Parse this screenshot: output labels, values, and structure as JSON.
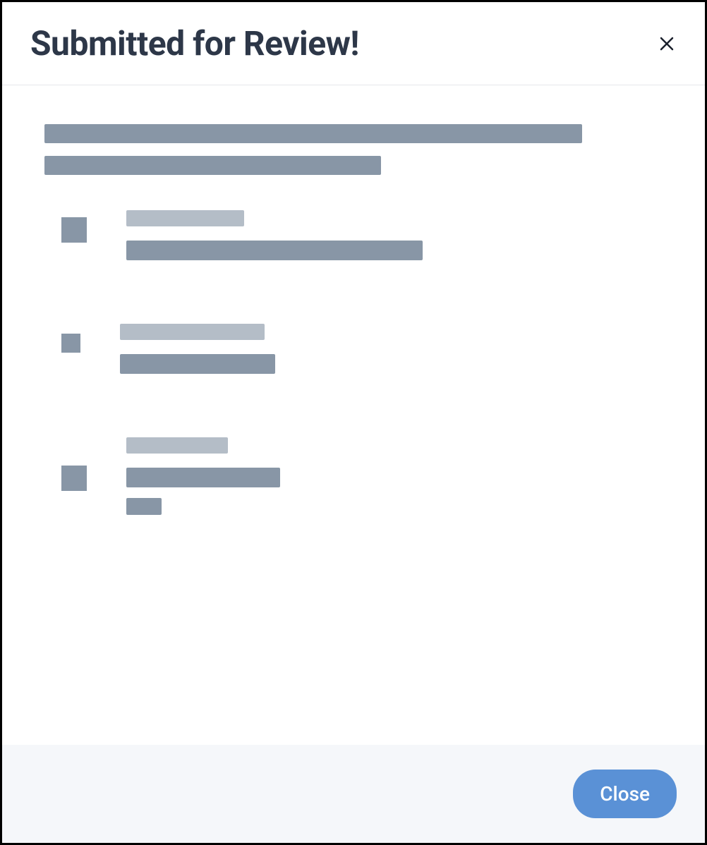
{
  "modal": {
    "title": "Submitted for Review!",
    "close_button_label": "Close"
  }
}
